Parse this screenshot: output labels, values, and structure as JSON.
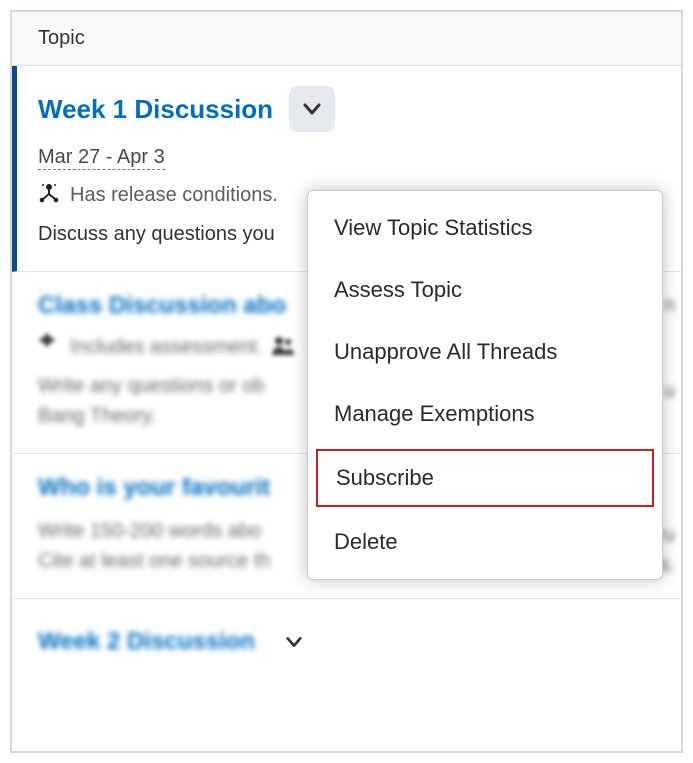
{
  "header": {
    "label": "Topic"
  },
  "topics": [
    {
      "title": "Week 1 Discussion",
      "date_range": "Mar 27 - Apr 3",
      "release_text": "Has release conditions.",
      "desc": "Discuss any questions you"
    },
    {
      "title": "Class Discussion abo",
      "meta": "Includes assessment.",
      "desc1": "Write any questions or ob",
      "desc2": "Bang Theory."
    },
    {
      "title": "Who is your favourit",
      "desc1": "Write 150-200 words abo",
      "desc2": "Cite at least one source th"
    },
    {
      "title": "Week 2 Discussion"
    }
  ],
  "menu": {
    "items": [
      "View Topic Statistics",
      "Assess Topic",
      "Unapprove All Threads",
      "Manage Exemptions",
      "Subscribe",
      "Delete"
    ]
  },
  "obscured": {
    "a": "n",
    "b": "u",
    "c": "ru",
    "d": "s."
  }
}
